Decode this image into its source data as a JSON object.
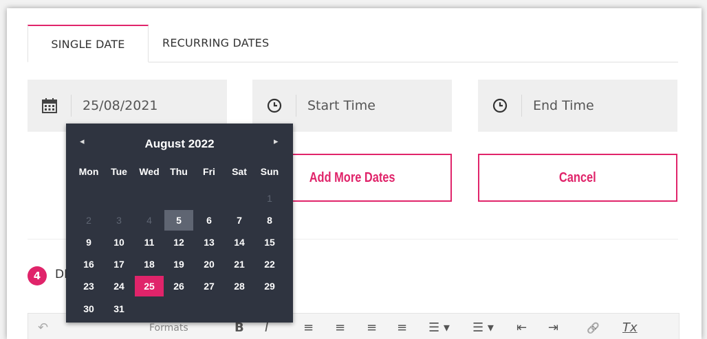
{
  "tabs": [
    {
      "label": "SINGLE DATE",
      "active": true
    },
    {
      "label": "RECURRING DATES",
      "active": false
    }
  ],
  "fields": {
    "date": {
      "value": "25/08/2021",
      "icon": "calendar-icon"
    },
    "start_time": {
      "placeholder": "Start Time",
      "icon": "clock-icon"
    },
    "end_time": {
      "placeholder": "End Time",
      "icon": "clock-icon"
    }
  },
  "buttons": {
    "add_more": "Add More Dates",
    "cancel": "Cancel"
  },
  "step": {
    "number": "4",
    "label": "DE"
  },
  "calendar": {
    "prev": "◂",
    "next": "▸",
    "title": "August 2022",
    "weekdays": [
      "Mon",
      "Tue",
      "Wed",
      "Thu",
      "Fri",
      "Sat",
      "Sun"
    ],
    "weeks": [
      [
        "",
        "",
        "",
        "",
        "",
        "",
        "1"
      ],
      [
        "2",
        "3",
        "4",
        "5",
        "6",
        "7",
        "8"
      ],
      [
        "9",
        "10",
        "11",
        "12",
        "13",
        "14",
        "15"
      ],
      [
        "16",
        "17",
        "18",
        "19",
        "20",
        "21",
        "22"
      ],
      [
        "23",
        "24",
        "25",
        "26",
        "27",
        "28",
        "29"
      ],
      [
        "30",
        "31",
        "",
        "",
        "",
        "",
        ""
      ]
    ],
    "disabled_days": [
      "1",
      "2",
      "3",
      "4"
    ],
    "today": "5",
    "selected": "25"
  },
  "toolbar": {
    "undo": "↶",
    "formats": "Formats",
    "bold": "B",
    "italic": "I",
    "align_left": "≡",
    "align_center": "≡",
    "align_right": "≡",
    "justify": "≡",
    "bullet_list": "☰ ▾",
    "numbered_list": "☰ ▾",
    "outdent": "⇤",
    "indent": "⇥",
    "link": "🔗",
    "clear_format": "Tx"
  },
  "colors": {
    "accent": "#e0246a",
    "calendar_bg": "#2f3440",
    "field_bg": "#efefef"
  }
}
